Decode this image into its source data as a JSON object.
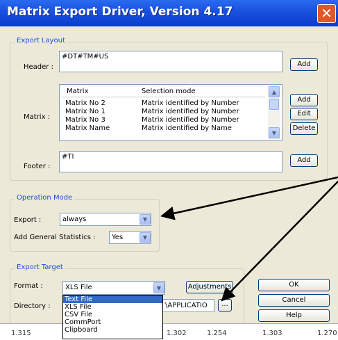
{
  "window": {
    "title": "Matrix Export Driver, Version 4.17",
    "close_glyph": "✕"
  },
  "export_layout": {
    "group_title": "Export Layout",
    "header_label": "Header :",
    "header_value": "#DT#TM#US",
    "header_add": "Add",
    "matrix_label": "Matrix :",
    "matrix_columns": [
      "Matrix",
      "Selection mode"
    ],
    "matrix_rows": [
      {
        "matrix": "Matrix No 2",
        "mode": "Matrix identified by Number"
      },
      {
        "matrix": "Matrix No 1",
        "mode": "Matrix identified by Number"
      },
      {
        "matrix": "Matrix No 3",
        "mode": "Matrix identified by Number"
      },
      {
        "matrix": "Matrix Name",
        "mode": "Matrix identified by Name"
      }
    ],
    "matrix_add": "Add",
    "matrix_edit": "Edit",
    "matrix_delete": "Delete",
    "footer_label": "Footer :",
    "footer_value": "#TI",
    "footer_add": "Add"
  },
  "operation_mode": {
    "group_title": "Operation Mode",
    "export_label": "Export :",
    "export_value": "always",
    "stats_label": "Add General Statistics :",
    "stats_value": "Yes"
  },
  "export_target": {
    "group_title": "Export Target",
    "format_label": "Format :",
    "format_value": "XLS File",
    "adjustments": "Adjustments",
    "directory_label": "Directory :",
    "directory_value": "\\APPLICATIO",
    "browse": "...",
    "format_options": [
      "Text File",
      "XLS File",
      "CSV File",
      "CommPort",
      "Clipboard"
    ],
    "format_highlighted": "Text File"
  },
  "dialog_buttons": {
    "ok": "OK",
    "cancel": "Cancel",
    "help": "Help"
  },
  "background_row": [
    "1.315",
    "1.302",
    "1.254",
    "1.303",
    "1.270"
  ],
  "colors": {
    "title_blue": "#0a3dcc",
    "group_title": "#1a4fd8",
    "selection": "#316ac5"
  }
}
